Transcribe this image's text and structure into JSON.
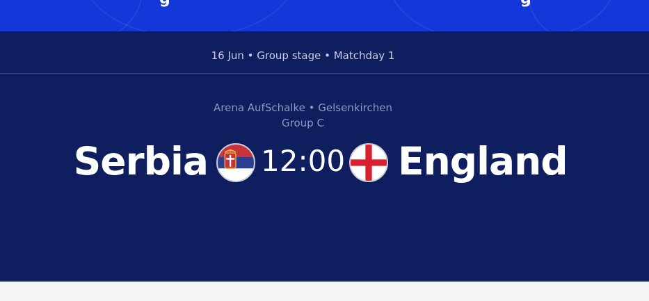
{
  "match": {
    "meta": "16 Jun • Group stage • Matchday 1",
    "venue": "Arena AufSchalke • Gelsenkirchen",
    "group": "Group C",
    "home_team": "Serbia",
    "away_team": "England",
    "kickoff_time": "12:00",
    "home_flag_icon": "serbia-flag-icon",
    "away_flag_icon": "england-flag-icon"
  },
  "colors": {
    "banner": "#1437d9",
    "background": "#0e1e5e",
    "footer": "#f3f4f6",
    "text_primary": "#ffffff",
    "text_secondary": "#8f98bf"
  }
}
